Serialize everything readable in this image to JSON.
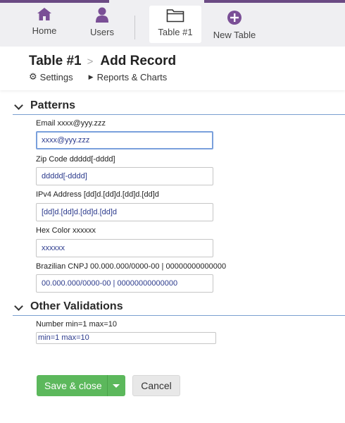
{
  "nav": {
    "home_label": "Home",
    "users_label": "Users",
    "table_label": "Table #1",
    "new_table_label": "New Table"
  },
  "header": {
    "breadcrumb_table": "Table #1",
    "breadcrumb_separator": ">",
    "page_title": "Add Record",
    "settings_label": "Settings",
    "reports_label": "Reports & Charts"
  },
  "sections": {
    "patterns_title": "Patterns",
    "other_title": "Other Validations"
  },
  "fields": {
    "email": {
      "label": "Email xxxx@yyy.zzz",
      "placeholder": "xxxx@yyy.zzz"
    },
    "zip": {
      "label": "Zip Code ddddd[-dddd]",
      "placeholder": "ddddd[-dddd]"
    },
    "ipv4": {
      "label": "IPv4 Address [dd]d.[dd]d.[dd]d.[dd]d",
      "placeholder": "[dd]d.[dd]d.[dd]d.[dd]d"
    },
    "hex": {
      "label": "Hex Color xxxxxx",
      "placeholder": "xxxxxx"
    },
    "cnpj": {
      "label": "Brazilian CNPJ 00.000.000/0000-00 | 00000000000000",
      "placeholder": "00.000.000/0000-00 | 00000000000000"
    },
    "number": {
      "label": "Number min=1 max=10",
      "placeholder": "min=1 max=10"
    }
  },
  "actions": {
    "save_label": "Save & close",
    "cancel_label": "Cancel"
  },
  "colors": {
    "brand": "#6b4a84",
    "save": "#5cb85c",
    "focus_border": "#7aa0dc",
    "section_rule": "#7a9fd0"
  },
  "icons": [
    "home-icon",
    "user-icon",
    "folder-icon",
    "plus-circle-icon",
    "gear-icon",
    "caret-right-icon",
    "chevron-down-icon",
    "caret-down-icon"
  ]
}
